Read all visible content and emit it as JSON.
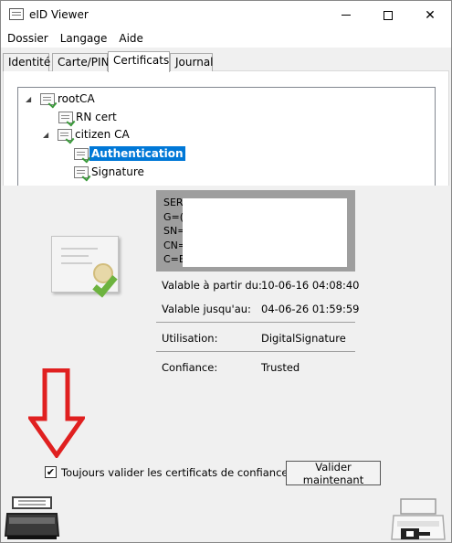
{
  "window": {
    "title": "eID Viewer"
  },
  "menu": [
    "Dossier",
    "Langage",
    "Aide"
  ],
  "tabs": [
    "Identité",
    "Carte/PIN",
    "Certificats",
    "Journal"
  ],
  "active_tab": "Certificats",
  "tree": {
    "nodes": [
      {
        "label": "rootCA",
        "expanded": true
      },
      {
        "label": "RN cert"
      },
      {
        "label": "citizen CA",
        "expanded": true
      },
      {
        "label": "Authentication",
        "selected": true
      },
      {
        "label": "Signature"
      }
    ]
  },
  "subject": {
    "lines": [
      "SERI",
      "G=(",
      "SN=",
      "CN=",
      "C=B"
    ]
  },
  "details": {
    "valid_from_label": "Valable à partir du:",
    "valid_from": "10-06-16 04:08:40",
    "valid_to_label": "Valable jusqu'au:",
    "valid_to": "04-06-26 01:59:59",
    "usage_label": "Utilisation:",
    "usage": "DigitalSignature",
    "trust_label": "Confiance:",
    "trust": "Trusted"
  },
  "always_validate": {
    "label": "Toujours valider les certificats de confiance",
    "checked": true,
    "mark": "✔"
  },
  "validate_button": "Valider maintenant",
  "colors": {
    "selection": "#0078d7",
    "arrow": "#e02020",
    "check": "#6db33f"
  },
  "icons": [
    "app-icon",
    "minimize-icon",
    "maximize-icon",
    "close-icon",
    "certificate-icon",
    "card-reader-icon",
    "card-inserted-reader-icon"
  ]
}
